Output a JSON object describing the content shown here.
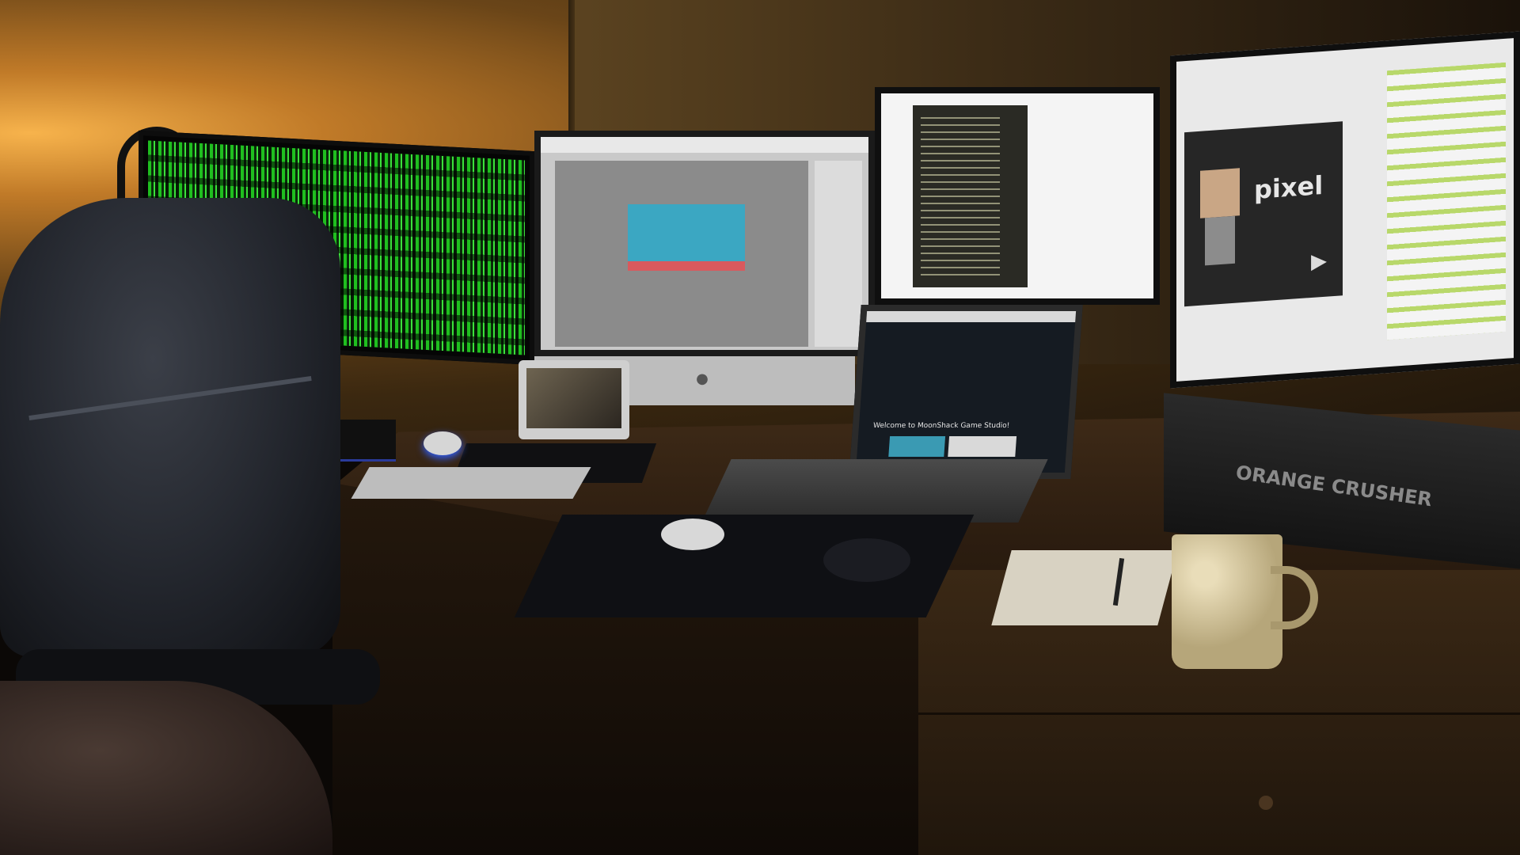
{
  "scene": {
    "description_visible_text": {
      "game_logo": "pixel",
      "laptop_welcome": "Welcome to MoonShack Game Studio!",
      "amp_brand": "ORANGE CRUSHER"
    },
    "colors": {
      "matrix_green": "#1fbf1f",
      "wall_glow": "#f7b34c",
      "game_sky": "#3ba7c2",
      "game_ground": "#d9595d",
      "chat_highlight": "#b8d86a",
      "led_blue": "#2f5fff"
    },
    "icons": {
      "apple_logo": "apple-icon",
      "play_arrow": "play-arrow-icon"
    }
  }
}
